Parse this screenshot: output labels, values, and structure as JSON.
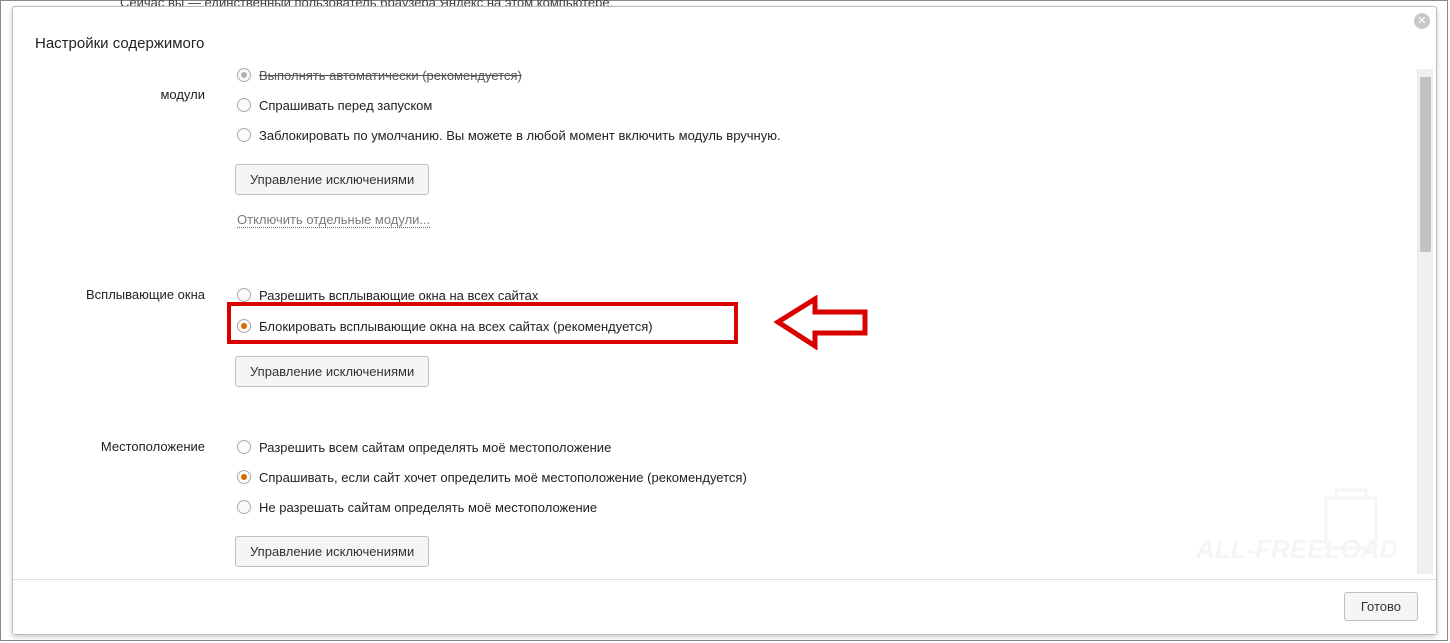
{
  "bg_hint": "Сейчас вы — единственный пользователь браузера Яндекс на этом компьютере.",
  "dialog": {
    "title": "Настройки содержимого",
    "done_button": "Готово"
  },
  "modules": {
    "label": "Подключаемые модули",
    "label_line2": "модули",
    "opt_auto": "Выполнять автоматически (рекомендуется)",
    "opt_ask": "Спрашивать перед запуском",
    "opt_block": "Заблокировать по умолчанию. Вы можете в любой момент включить модуль вручную.",
    "btn_exceptions": "Управление исключениями",
    "link_disable": "Отключить отдельные модули..."
  },
  "popups": {
    "label": "Всплывающие окна",
    "opt_allow": "Разрешить всплывающие окна на всех сайтах",
    "opt_block": "Блокировать всплывающие окна на всех сайтах (рекомендуется)",
    "btn_exceptions": "Управление исключениями"
  },
  "location": {
    "label": "Местоположение",
    "opt_allow": "Разрешить всем сайтам определять моё местоположение",
    "opt_ask": "Спрашивать, если сайт хочет определить моё местоположение (рекомендуется)",
    "opt_deny": "Не разрешать сайтам определять моё местоположение",
    "btn_exceptions": "Управление исключениями"
  }
}
